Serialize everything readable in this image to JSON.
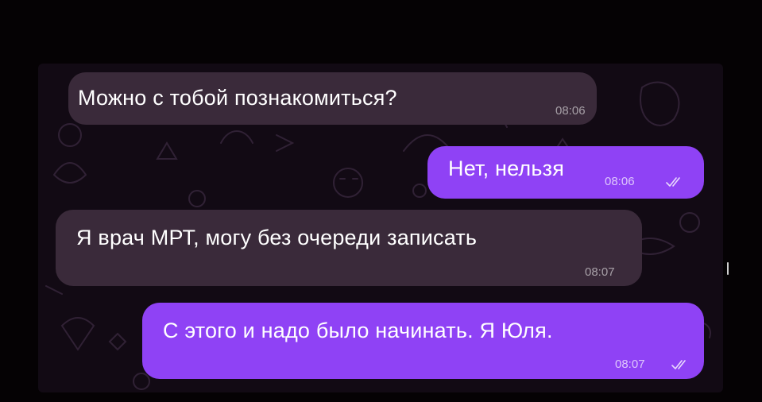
{
  "chat": {
    "messages": [
      {
        "direction": "incoming",
        "text": "Можно с тобой познакомиться?",
        "time": "08:06"
      },
      {
        "direction": "outgoing",
        "text": "Нет, нельзя",
        "time": "08:06",
        "status": "read"
      },
      {
        "direction": "incoming",
        "text": "Я врач МРТ, могу без очереди записать",
        "time": "08:07"
      },
      {
        "direction": "outgoing",
        "text": "С этого и надо было начинать. Я Юля.",
        "time": "08:07",
        "status": "read"
      }
    ]
  },
  "colors": {
    "background": "#050204",
    "chat_background": "#120a14",
    "incoming_bubble": "#3a2a3a",
    "outgoing_bubble": "#8f42f5",
    "text": "#ffffff"
  },
  "icons": {
    "read_status": "double-check-icon"
  }
}
